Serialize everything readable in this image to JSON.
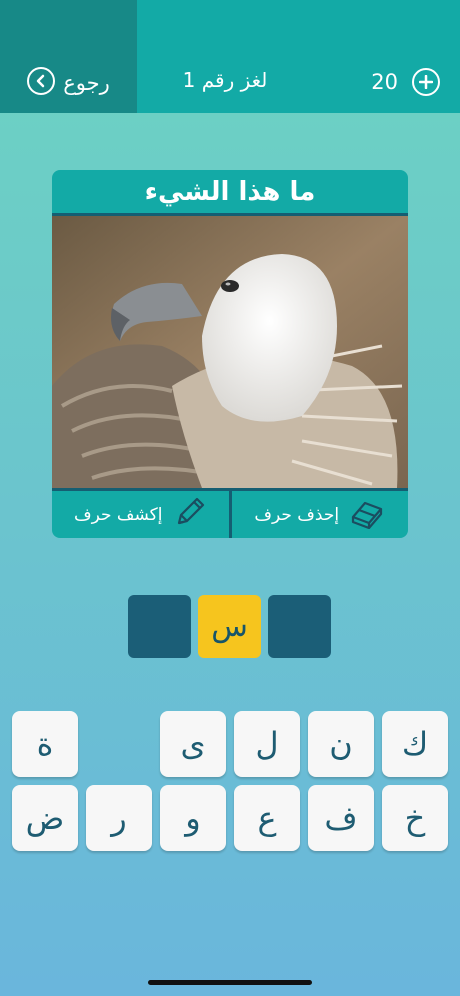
{
  "topbar": {
    "back_label": "رجوع",
    "title": "لغز رقم 1",
    "coins": "20"
  },
  "card": {
    "question": "ما هذا الشيء",
    "image_subject": "vulture",
    "actions": [
      {
        "label": "إكشف حرف",
        "icon": "pencil-icon"
      },
      {
        "label": "إحذف حرف",
        "icon": "eraser-icon"
      }
    ]
  },
  "answer": {
    "slots": [
      "",
      "س",
      ""
    ]
  },
  "keyboard": {
    "row1": [
      "ة",
      "",
      "ى",
      "ل",
      "ن",
      "ك"
    ],
    "row2": [
      "ض",
      "ر",
      "و",
      "ع",
      "ف",
      "خ"
    ]
  },
  "colors": {
    "topbar": "#13aaa6",
    "back_button": "#178987",
    "slot_empty": "#1b5e77",
    "slot_filled": "#f6c51e",
    "key": "#f7f7f7"
  }
}
